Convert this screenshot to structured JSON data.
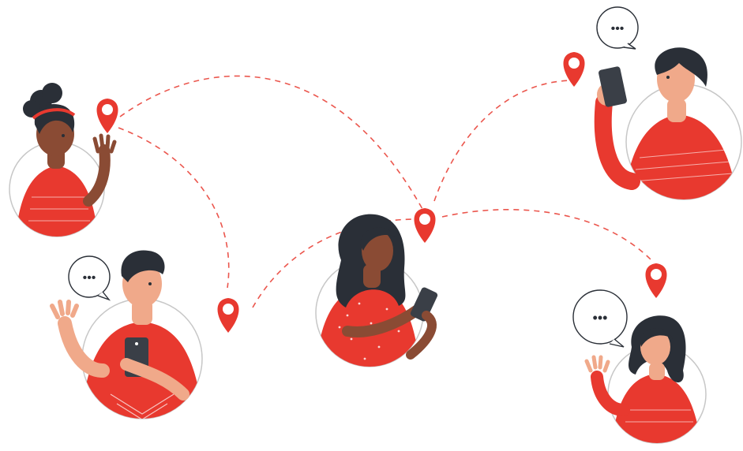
{
  "illustration": {
    "people": [
      {
        "id": "woman-topleft",
        "shirt": "#e8392f"
      },
      {
        "id": "man-bottomleft",
        "shirt": "#e8392f"
      },
      {
        "id": "woman-center",
        "shirt": "#e8392f"
      },
      {
        "id": "man-topright",
        "shirt": "#e8392f"
      },
      {
        "id": "woman-bottomright",
        "shirt": "#e8392f"
      }
    ],
    "chat_bubbles": [
      {
        "text": "•••"
      },
      {
        "text": "•••"
      },
      {
        "text": "•••"
      }
    ],
    "icons": [
      "location-pin-icon",
      "speech-bubble-icon",
      "smartphone-icon"
    ]
  },
  "colors": {
    "accent": "#e8392f",
    "pin": "#e8392f",
    "skin_light": "#f0a98a",
    "skin_dark": "#8a4b34",
    "hair": "#2a2f37",
    "outline": "#c7c7c7",
    "phone": "#3a3f47"
  }
}
